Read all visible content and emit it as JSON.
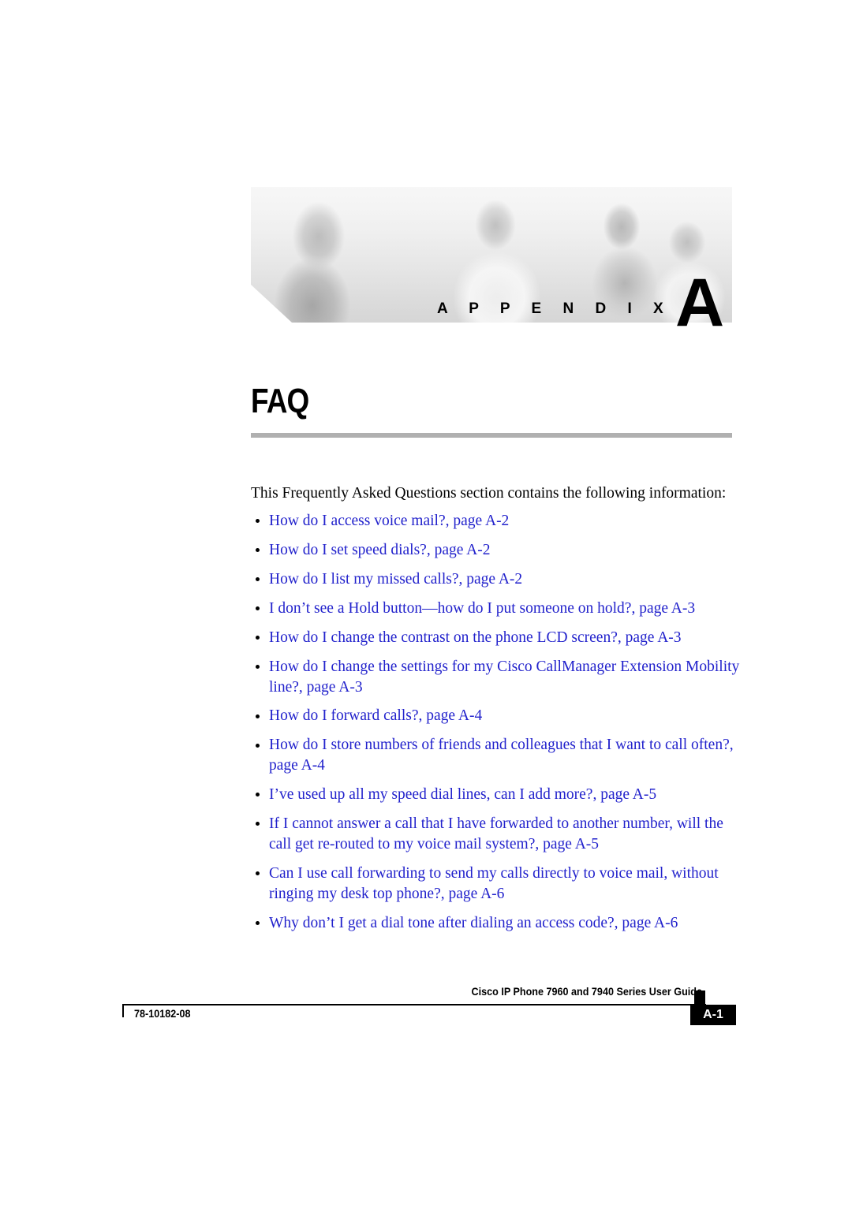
{
  "banner": {
    "appendix_word": "A P P E N D I X",
    "appendix_letter": "A"
  },
  "title": "FAQ",
  "intro": "This Frequently Asked Questions section contains the following information:",
  "bullets": [
    "How do I access voice mail?, page A-2",
    "How do I set speed dials?, page A-2",
    "How do I list my missed calls?, page A-2",
    "I don’t see a Hold button—how do I put someone on hold?, page A-3",
    "How do I change the contrast on the phone LCD screen?, page A-3",
    "How do I change the settings for my Cisco CallManager Extension Mobility line?, page A-3",
    "How do I forward calls?, page A-4",
    "How do I store numbers of friends and colleagues that I want to call often?, page A-4",
    "I’ve used up all my speed dial lines, can I add more?, page A-5",
    "If I cannot answer a call that I have forwarded to another number, will the call get re-routed to my voice mail system?, page A-5",
    "Can I use call forwarding to send my calls directly to voice mail, without ringing my desk top phone?, page A-6",
    "Why don’t I get a dial tone after dialing an access code?, page A-6"
  ],
  "footer": {
    "guide_title": "Cisco IP Phone 7960 and 7940 Series User Guide",
    "doc_number": "78-10182-08",
    "page_label": "A-1"
  },
  "colors": {
    "link_blue": "#2222CC",
    "rule_gray": "#B0B0B0",
    "text_black": "#000000"
  }
}
